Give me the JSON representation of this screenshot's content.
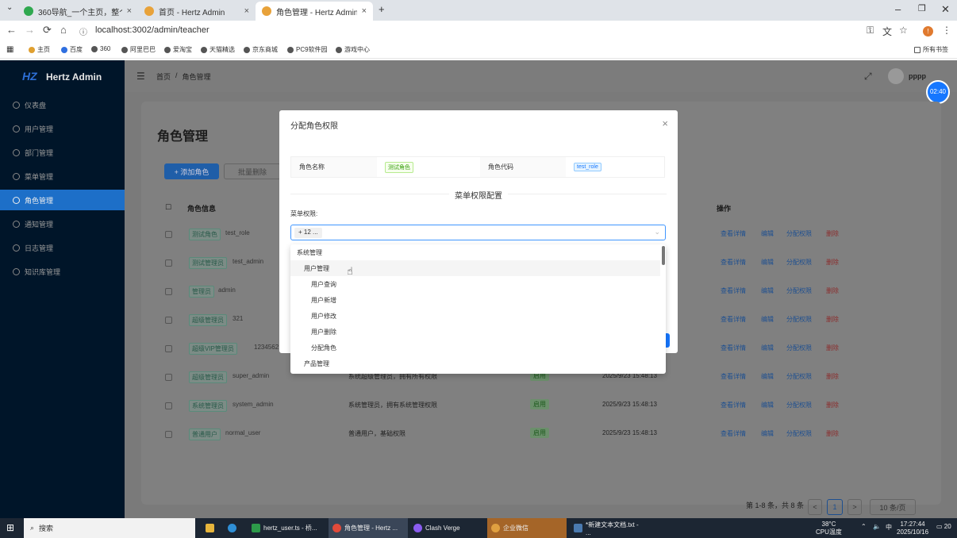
{
  "browser": {
    "tabs": [
      {
        "title": "360导航_一个主页，整个世界",
        "fav": "#2fa84f"
      },
      {
        "title": "首页 - Hertz Admin",
        "fav": "#e8a23a"
      },
      {
        "title": "角色管理 - Hertz Admin",
        "fav": "#e8a23a"
      }
    ],
    "new_tab": "+",
    "url": "localhost:3002/admin/teacher",
    "profile_initial": "!",
    "bookmarks": [
      "主页",
      "百度",
      "360",
      "阿里巴巴",
      "爱淘宝",
      "天猫精选",
      "京东商城",
      "PC9软件园",
      "游戏中心"
    ],
    "all_bookmarks": "所有书签"
  },
  "app": {
    "brand": "Hertz Admin",
    "sidebar": [
      {
        "label": "仪表盘"
      },
      {
        "label": "用户管理"
      },
      {
        "label": "部门管理"
      },
      {
        "label": "菜单管理"
      },
      {
        "label": "角色管理"
      },
      {
        "label": "通知管理"
      },
      {
        "label": "日志管理"
      },
      {
        "label": "知识库管理"
      }
    ],
    "breadcrumb": [
      "首页",
      "/",
      "角色管理"
    ],
    "user_name": "pppp",
    "clock": "02:40",
    "page_title": "角色管理",
    "add_button": "+ 添加角色",
    "batch_button": "批量删除",
    "columns": {
      "info": "角色信息",
      "actions": "操作"
    },
    "actions": {
      "view": "查看详情",
      "edit": "编辑",
      "assign": "分配权限",
      "delete": "删除"
    },
    "rows": [
      {
        "name": "测试角色",
        "code": "test_role",
        "desc": "",
        "status": "",
        "time": ""
      },
      {
        "name": "测试管理员",
        "code": "test_admin",
        "desc": "",
        "status": "",
        "time": ""
      },
      {
        "name": "管理员",
        "code": "admin",
        "desc": "",
        "status": "",
        "time": ""
      },
      {
        "name": "超级管理员",
        "code": "321",
        "desc": "",
        "status": "",
        "time": ""
      },
      {
        "name": "超级VIP管理员",
        "code": "1234562",
        "desc": "",
        "status": "",
        "time": ""
      },
      {
        "name": "超级管理员",
        "code": "super_admin",
        "desc": "系统超级管理员，拥有所有权限",
        "status": "启用",
        "time": "2025/9/23 15:48:13"
      },
      {
        "name": "系统管理员",
        "code": "system_admin",
        "desc": "系统管理员，拥有系统管理权限",
        "status": "启用",
        "time": "2025/9/23 15:48:13"
      },
      {
        "name": "普通用户",
        "code": "normal_user",
        "desc": "普通用户，基础权限",
        "status": "启用",
        "time": "2025/9/23 15:48:13"
      }
    ],
    "pagination": {
      "summary": "第 1-8 条，共 8 条",
      "page": "1",
      "prev": "<",
      "next": ">",
      "size": "10 条/页"
    }
  },
  "modal": {
    "title": "分配角色权限",
    "close": "×",
    "role_name_label": "角色名称",
    "role_name": "测试角色",
    "role_code_label": "角色代码",
    "role_code": "test_role",
    "section": "菜单权限配置",
    "perm_label": "菜单权限:",
    "selected_tag": "+ 12 ...",
    "tree": [
      {
        "label": "系统管理",
        "level": 0
      },
      {
        "label": "用户管理",
        "level": 1,
        "hover": true
      },
      {
        "label": "用户查询",
        "level": 2
      },
      {
        "label": "用户新增",
        "level": 2
      },
      {
        "label": "用户修改",
        "level": 2
      },
      {
        "label": "用户删除",
        "level": 2
      },
      {
        "label": "分配角色",
        "level": 2
      },
      {
        "label": "产品管理",
        "level": 1
      }
    ]
  },
  "taskbar": {
    "search": "搜索",
    "apps": [
      {
        "label": "hertz_user.ts - 桥...",
        "color": "#2d9a4a"
      },
      {
        "label": "角色管理 - Hertz ...",
        "color": "#e24a3a"
      },
      {
        "label": "Clash Verge",
        "color": "#8a5cf0"
      },
      {
        "label": "企业微信",
        "color": "#e0a040"
      },
      {
        "label": "*新建文本文档.txt - ...",
        "color": "#4a7ab0"
      }
    ],
    "temp": "38°C",
    "cpu": "CPU温度",
    "ime": "中",
    "time": "17:27:44",
    "date": "2025/10/16",
    "notif": "20"
  }
}
